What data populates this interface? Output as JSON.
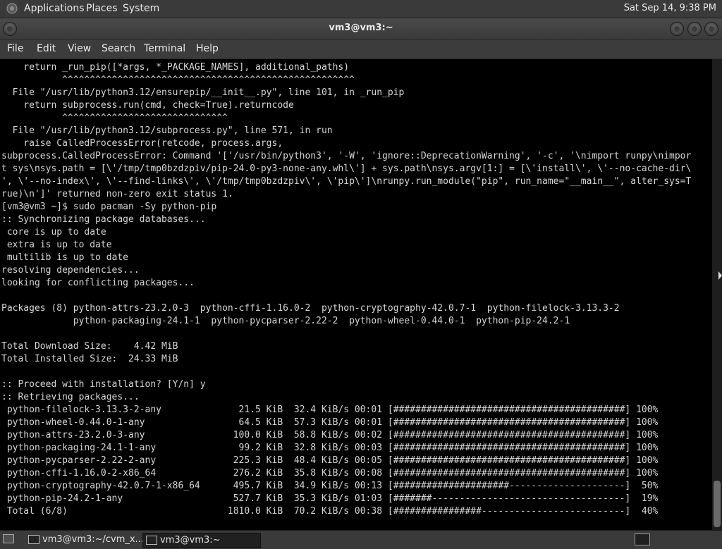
{
  "top_panel": {
    "menus": [
      "Applications",
      "Places",
      "System"
    ],
    "clock": "Sat Sep 14,  9:38 PM"
  },
  "window": {
    "title": "vm3@vm3:~",
    "menu": [
      "File",
      "Edit",
      "View",
      "Search",
      "Terminal",
      "Help"
    ]
  },
  "terminal": {
    "lines": [
      "    return _run_pip([*args, *_PACKAGE_NAMES], additional_paths)",
      "           ^^^^^^^^^^^^^^^^^^^^^^^^^^^^^^^^^^^^^^^^^^^^^^^^^^^^^",
      "  File \"/usr/lib/python3.12/ensurepip/__init__.py\", line 101, in _run_pip",
      "    return subprocess.run(cmd, check=True).returncode",
      "           ^^^^^^^^^^^^^^^^^^^^^^^^^^^^^^",
      "  File \"/usr/lib/python3.12/subprocess.py\", line 571, in run",
      "    raise CalledProcessError(retcode, process.args,",
      "subprocess.CalledProcessError: Command '['/usr/bin/python3', '-W', 'ignore::DeprecationWarning', '-c', '\\nimport runpy\\nimpor",
      "t sys\\nsys.path = [\\'/tmp/tmp0bzdzpiv/pip-24.0-py3-none-any.whl\\'] + sys.path\\nsys.argv[1:] = [\\'install\\', \\'--no-cache-dir\\",
      "', \\'--no-index\\', \\'--find-links\\', \\'/tmp/tmp0bzdzpiv\\', \\'pip\\']\\nrunpy.run_module(\"pip\", run_name=\"__main__\", alter_sys=T",
      "rue)\\n']' returned non-zero exit status 1.",
      "[vm3@vm3 ~]$ sudo pacman -Sy python-pip",
      ":: Synchronizing package databases...",
      " core is up to date",
      " extra is up to date",
      " multilib is up to date",
      "resolving dependencies...",
      "looking for conflicting packages...",
      "",
      "Packages (8) python-attrs-23.2.0-3  python-cffi-1.16.0-2  python-cryptography-42.0.7-1  python-filelock-3.13.3-2",
      "             python-packaging-24.1-1  python-pycparser-2.22-2  python-wheel-0.44.0-1  python-pip-24.2-1",
      "",
      "Total Download Size:    4.42 MiB",
      "Total Installed Size:  24.33 MiB",
      "",
      ":: Proceed with installation? [Y/n] y",
      ":: Retrieving packages...",
      " python-filelock-3.13.3-2-any              21.5 KiB  32.4 KiB/s 00:01 [##########################################] 100%",
      " python-wheel-0.44.0-1-any                 64.5 KiB  57.3 KiB/s 00:01 [##########################################] 100%",
      " python-attrs-23.2.0-3-any                100.0 KiB  58.8 KiB/s 00:02 [##########################################] 100%",
      " python-packaging-24.1-1-any               99.2 KiB  32.8 KiB/s 00:03 [##########################################] 100%",
      " python-pycparser-2.22-2-any              225.3 KiB  48.4 KiB/s 00:05 [##########################################] 100%",
      " python-cffi-1.16.0-2-x86_64              276.2 KiB  35.8 KiB/s 00:08 [##########################################] 100%",
      " python-cryptography-42.0.7-1-x86_64      495.7 KiB  34.9 KiB/s 00:13 [#####################---------------------]  50%",
      " python-pip-24.2-1-any                    527.7 KiB  35.3 KiB/s 01:03 [#######-----------------------------------]  19%",
      " Total (6/8)                             1810.0 KiB  70.2 KiB/s 00:38 [################--------------------------]  40%"
    ]
  },
  "taskbar": {
    "tasks": [
      "vm3@vm3:~/cvm_x...",
      "vm3@vm3:~"
    ]
  },
  "icons": [
    "applications-icon",
    "close-icon",
    "maximize-icon",
    "minimize-icon",
    "terminal-icon",
    "show-desktop-icon",
    "workspace-icon"
  ]
}
